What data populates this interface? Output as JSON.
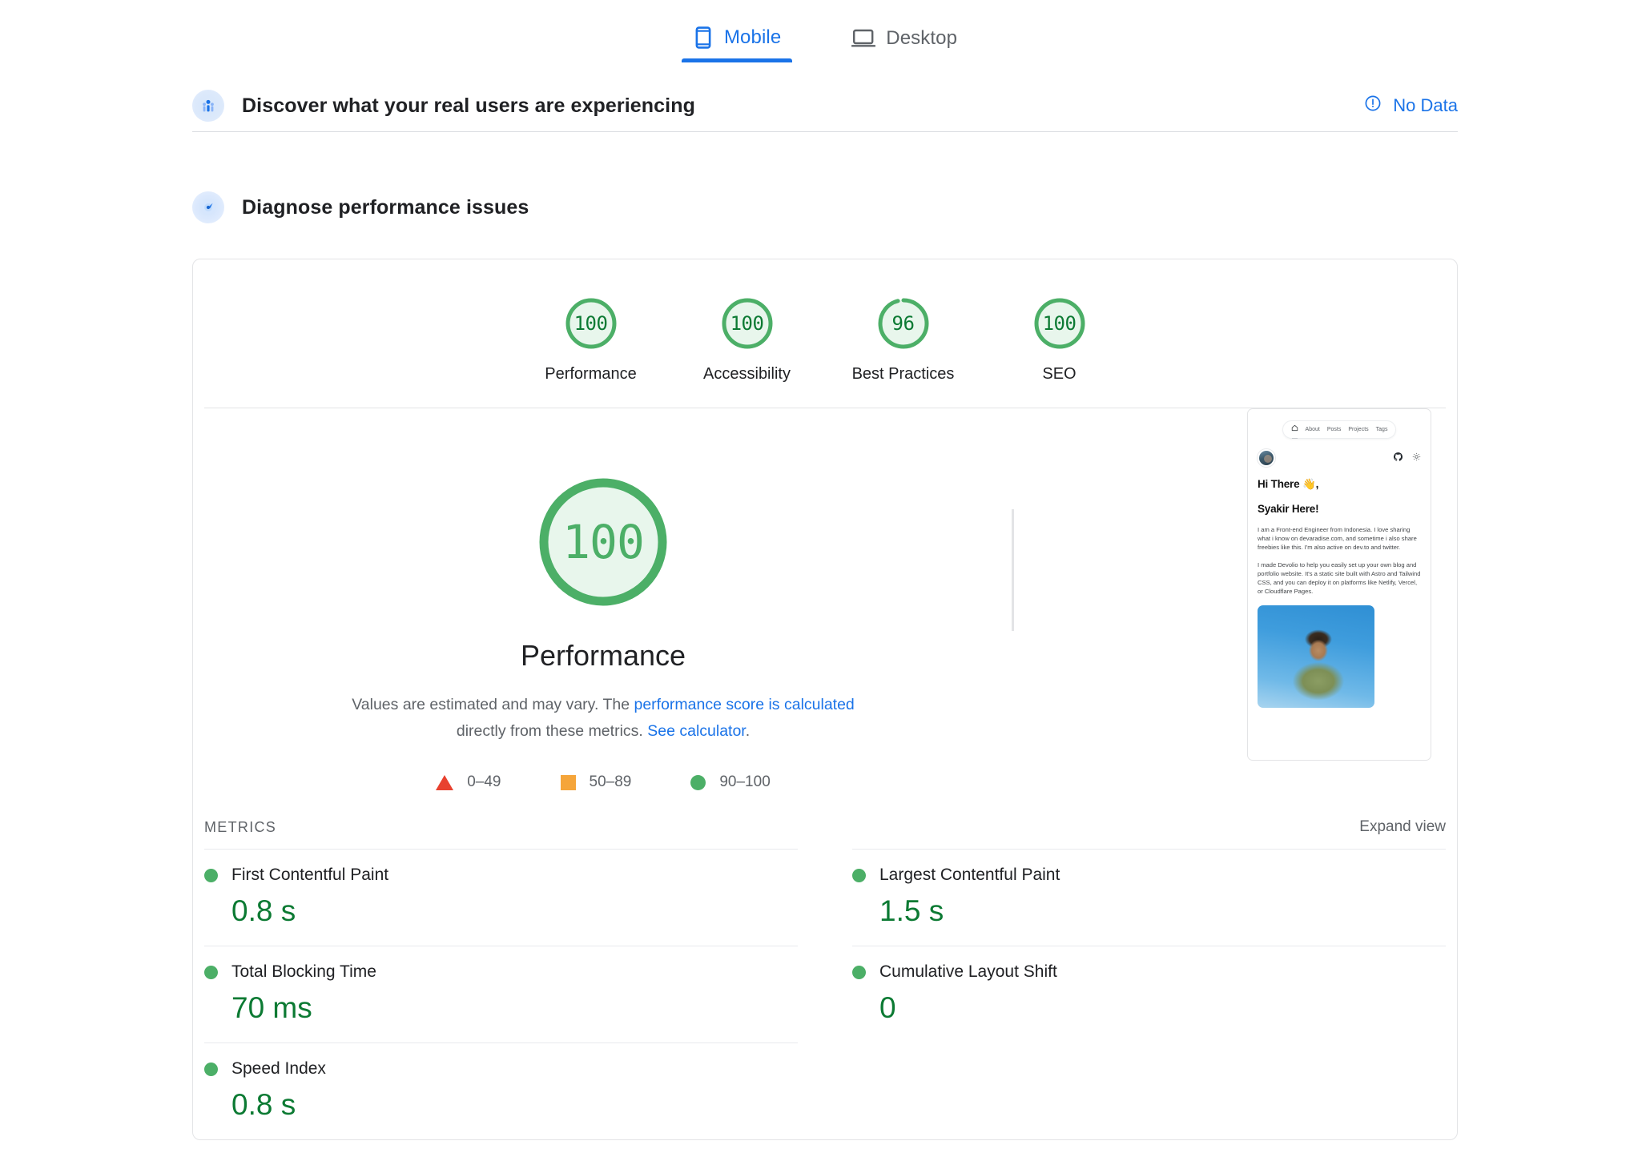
{
  "tabs": [
    {
      "label": "Mobile",
      "icon": "mobile-icon",
      "active": true
    },
    {
      "label": "Desktop",
      "icon": "desktop-icon",
      "active": false
    }
  ],
  "field_section": {
    "icon": "users-icon",
    "title": "Discover what your real users are experiencing",
    "status_label": "No Data",
    "status_icon": "info-circle-icon"
  },
  "lab_section": {
    "icon": "gauge-icon",
    "title": "Diagnose performance issues"
  },
  "category_scores": [
    {
      "label": "Performance",
      "score": "100",
      "value": 100
    },
    {
      "label": "Accessibility",
      "score": "100",
      "value": 100
    },
    {
      "label": "Best Practices",
      "score": "96",
      "value": 96
    },
    {
      "label": "SEO",
      "score": "100",
      "value": 100
    }
  ],
  "main_score": {
    "value": "100",
    "title": "Performance",
    "disclaimer_pre": "Values are estimated and may vary. The ",
    "disclaimer_link1": "performance score is calculated",
    "disclaimer_mid": " directly from these metrics. ",
    "disclaimer_link2": "See calculator",
    "disclaimer_end": "."
  },
  "legend": [
    {
      "shape": "triangle",
      "range": "0–49",
      "color": "#e8412f"
    },
    {
      "shape": "square",
      "range": "50–89",
      "color": "#f5a53a"
    },
    {
      "shape": "circle",
      "range": "90–100",
      "color": "#4caf67"
    }
  ],
  "metrics_header": {
    "title": "METRICS",
    "expand_label": "Expand view"
  },
  "metrics": {
    "left": [
      {
        "name": "First Contentful Paint",
        "value": "0.8 s",
        "status": "good"
      },
      {
        "name": "Total Blocking Time",
        "value": "70 ms",
        "status": "good"
      },
      {
        "name": "Speed Index",
        "value": "0.8 s",
        "status": "good"
      }
    ],
    "right": [
      {
        "name": "Largest Contentful Paint",
        "value": "1.5 s",
        "status": "good"
      },
      {
        "name": "Cumulative Layout Shift",
        "value": "0",
        "status": "good"
      }
    ]
  },
  "thumbnail": {
    "nav": {
      "home_icon": "home-icon",
      "items": [
        "About",
        "Posts",
        "Projects",
        "Tags"
      ]
    },
    "icons": [
      "github-icon",
      "theme-sun-icon"
    ],
    "heading_line1": "Hi There 👋,",
    "heading_line2": "Syakir Here!",
    "paragraph1": "I am a Front-end Engineer from Indonesia. I love sharing what i know on devaradise.com, and sometime i also share freebies like this. I'm also active on dev.to and twitter.",
    "paragraph2": "I made Devolio to help you easily set up your own blog and portfolio website. It's a static site built with Astro and Tailwind CSS, and you can deploy it on platforms like Netlify, Vercel, or Cloudflare Pages.",
    "photo_alt": "person-in-hoodie-photo"
  },
  "colors": {
    "accent_blue": "#1a73e8",
    "good_green": "#4caf67",
    "value_green": "#0c7a33",
    "average_orange": "#f5a53a",
    "poor_red": "#e8412f"
  }
}
